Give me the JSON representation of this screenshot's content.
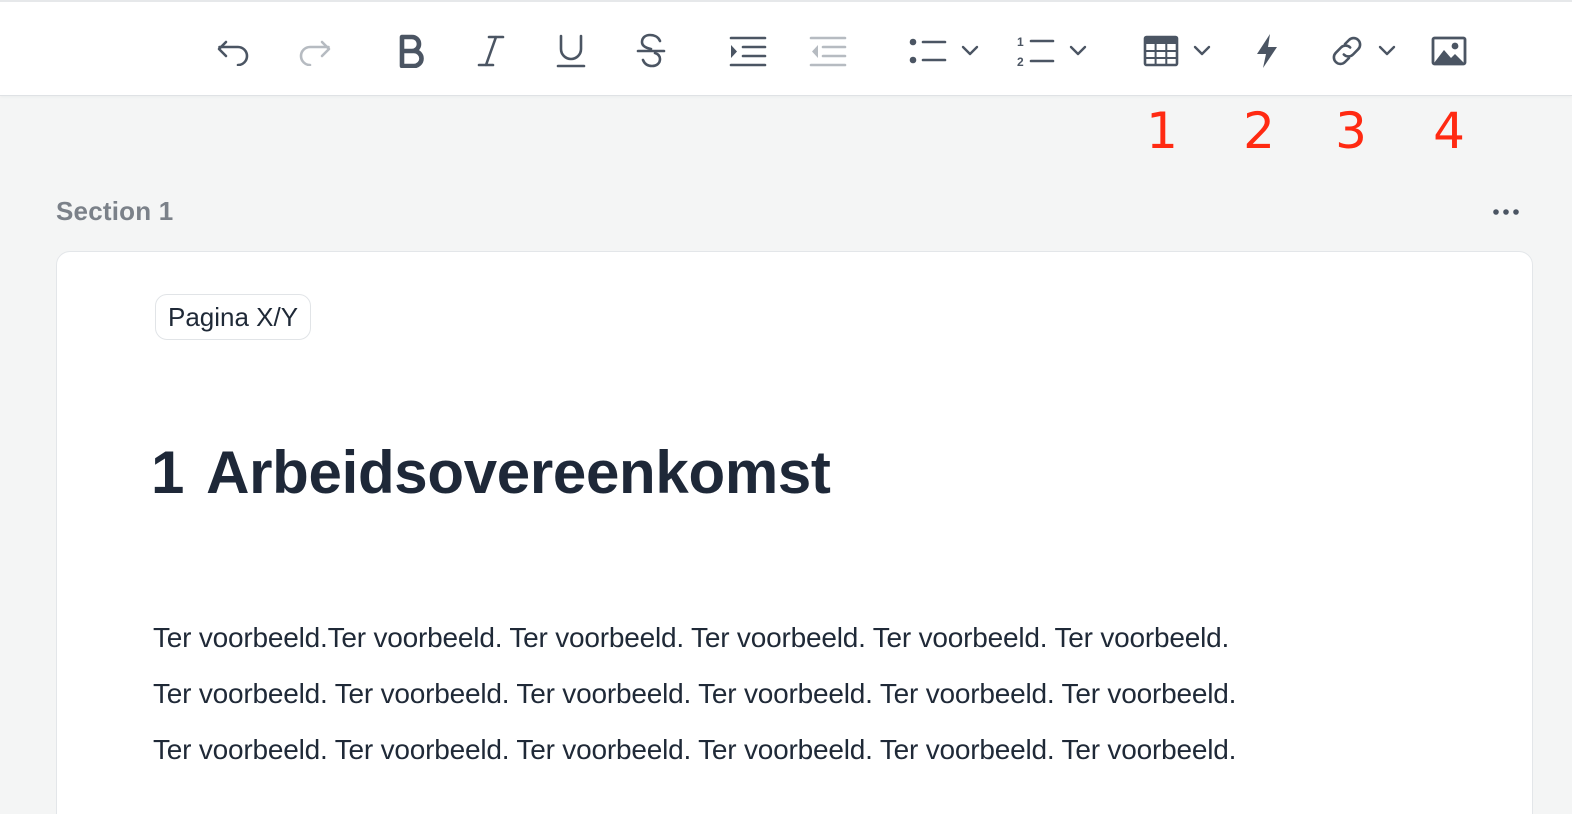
{
  "toolbar": {
    "buttons": [
      {
        "name": "undo",
        "icon": "undo-icon",
        "enabled": true
      },
      {
        "name": "redo",
        "icon": "redo-icon",
        "enabled": false
      },
      {
        "name": "bold",
        "icon": "bold-icon"
      },
      {
        "name": "italic",
        "icon": "italic-icon"
      },
      {
        "name": "underline",
        "icon": "underline-icon"
      },
      {
        "name": "strikethrough",
        "icon": "strikethrough-icon"
      },
      {
        "name": "indent",
        "icon": "indent-icon",
        "enabled": true
      },
      {
        "name": "outdent",
        "icon": "outdent-icon",
        "enabled": false
      },
      {
        "name": "bullet-list",
        "icon": "bullet-list-icon",
        "dropdown": true
      },
      {
        "name": "numbered-list",
        "icon": "numbered-list-icon",
        "dropdown": true
      },
      {
        "name": "table",
        "icon": "table-icon",
        "dropdown": true
      },
      {
        "name": "quick-action",
        "icon": "lightning-icon"
      },
      {
        "name": "link",
        "icon": "link-icon",
        "dropdown": true
      },
      {
        "name": "image",
        "icon": "image-icon"
      }
    ],
    "annotation_markers": [
      "1",
      "2",
      "3",
      "4"
    ],
    "marker_color": "#ff2a12",
    "icon_color": "#4b5563",
    "disabled_icon_color": "#b6bbc1"
  },
  "section": {
    "title": "Section 1",
    "more_icon": "ellipsis-icon"
  },
  "document": {
    "page_chip": "Pagina X/Y",
    "heading_number": "1",
    "heading_text": "Arbeidsovereenkomst",
    "paragraph_lines": [
      "Ter voorbeeld.Ter voorbeeld. Ter voorbeeld. Ter voorbeeld. Ter voorbeeld. Ter voorbeeld.",
      "Ter voorbeeld. Ter voorbeeld. Ter voorbeeld. Ter voorbeeld. Ter voorbeeld. Ter voorbeeld.",
      "Ter voorbeeld. Ter voorbeeld. Ter voorbeeld. Ter voorbeeld. Ter voorbeeld. Ter voorbeeld."
    ]
  }
}
